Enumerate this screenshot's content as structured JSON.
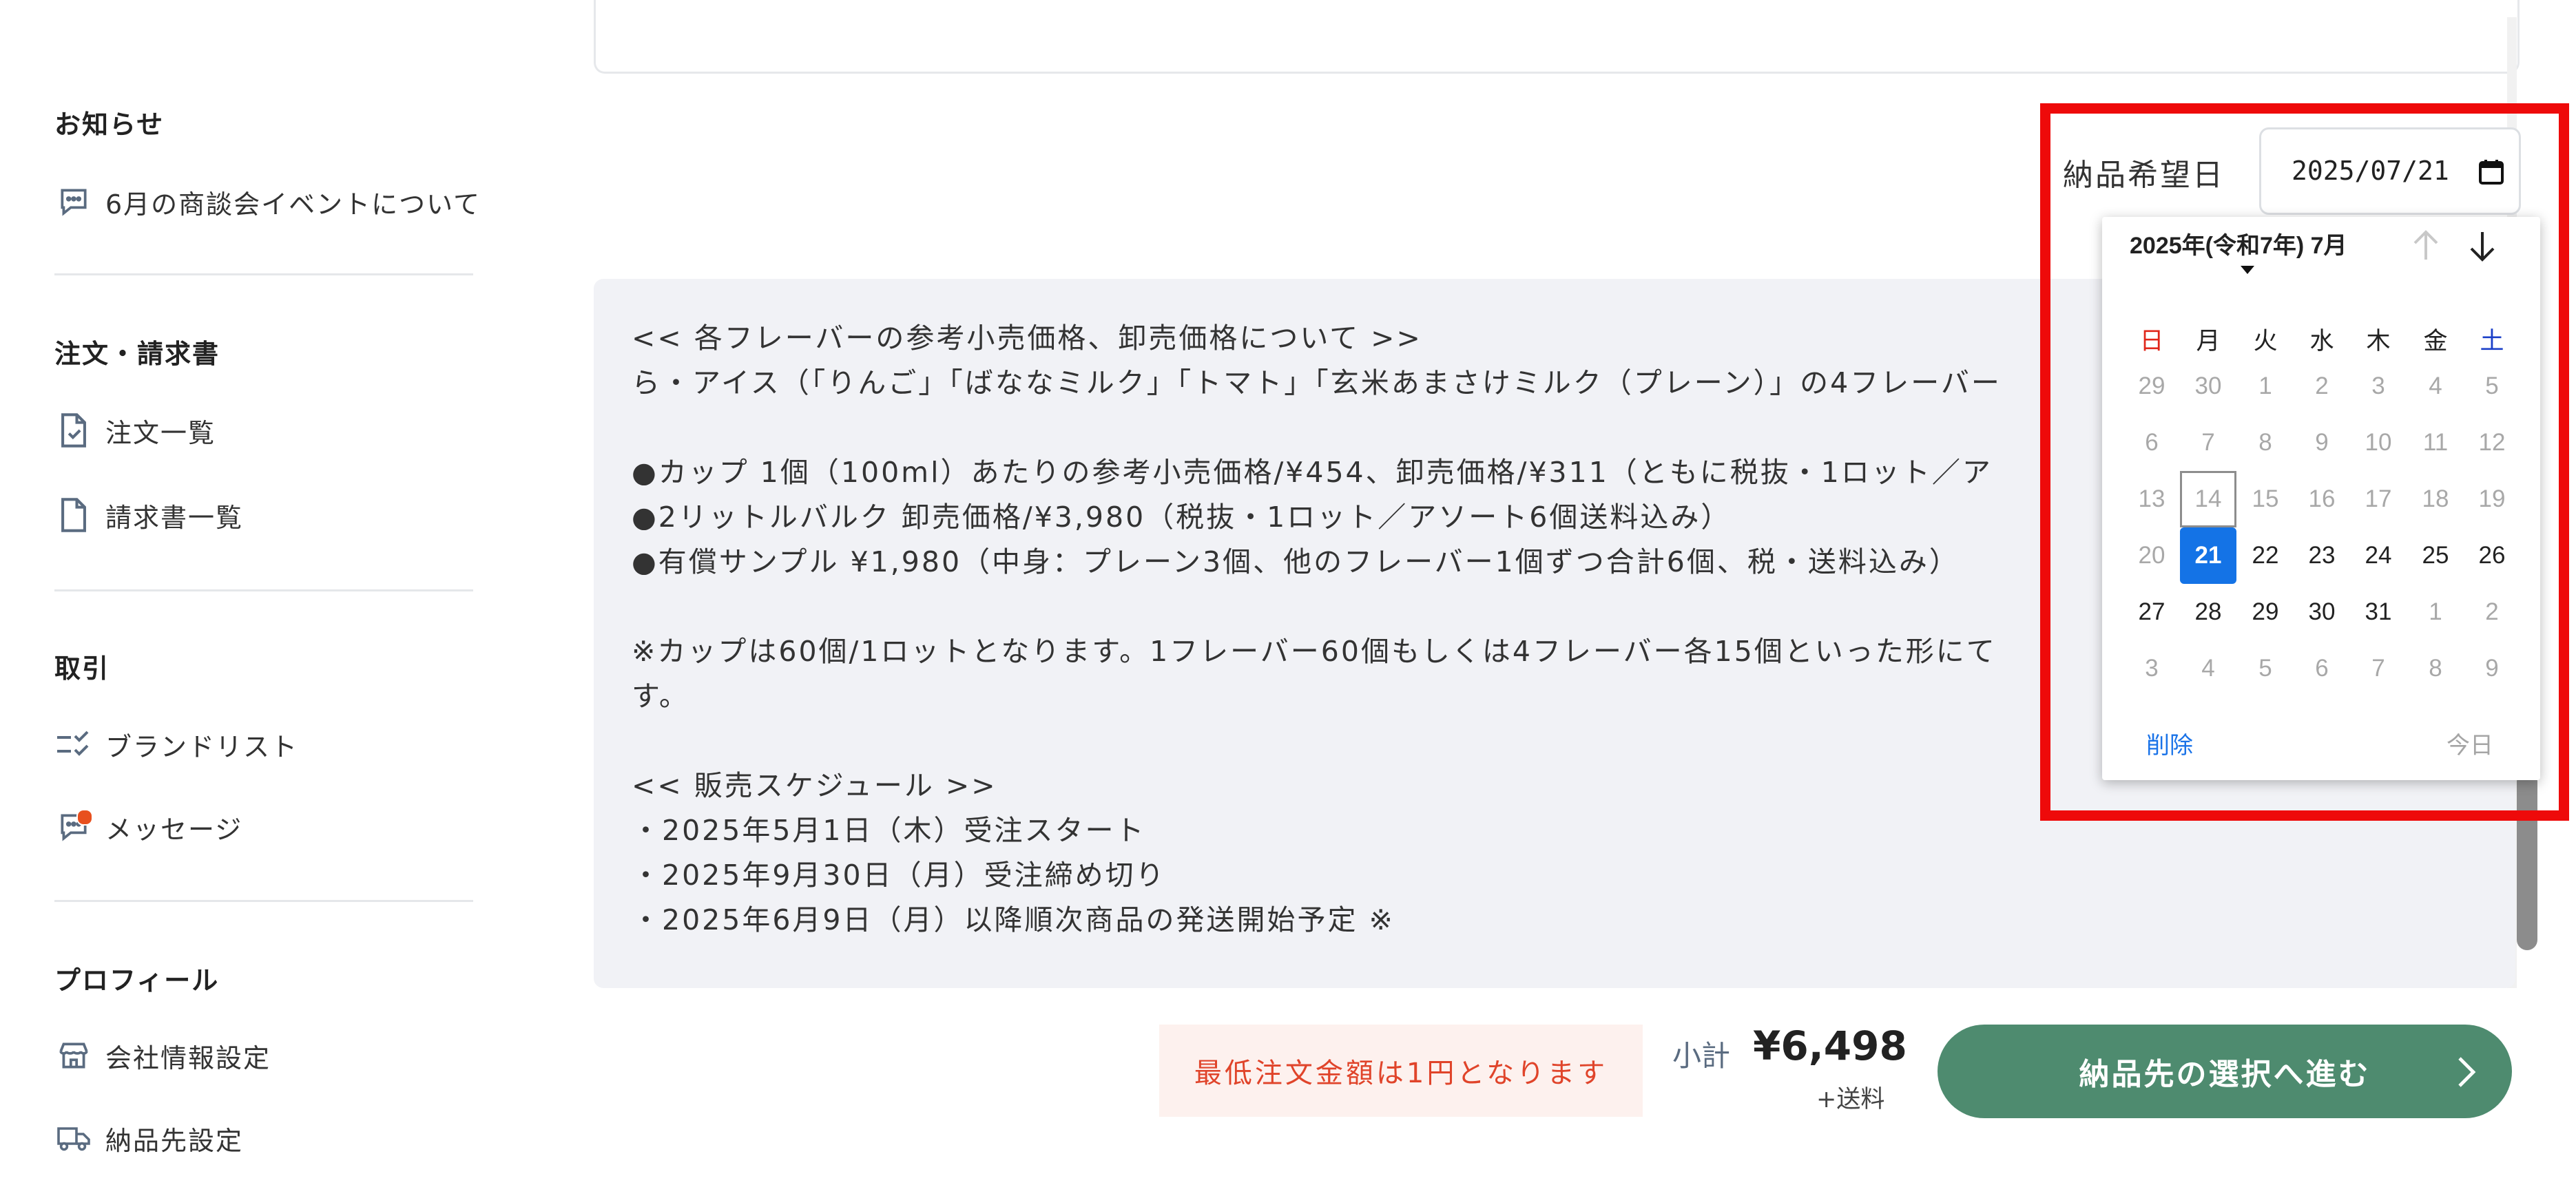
{
  "sidebar": {
    "notice_title": "お知らせ",
    "notice_item": "6月の商談会イベントについて",
    "orders_title": "注文・請求書",
    "order_list": "注文一覧",
    "invoice_list": "請求書一覧",
    "trade_title": "取引",
    "brand_list": "ブランドリスト",
    "messages": "メッセージ",
    "profile_title": "プロフィール",
    "company_settings": "会社情報設定",
    "delivery_settings": "納品先設定"
  },
  "description": {
    "lines": [
      "<< 各フレーバーの参考小売価格、卸売価格について >>",
      "ら・アイス（「りんご」「ばななミルク」「トマト」「玄米あまさけミルク（プレーン）」の4フレーバー",
      "",
      "●カップ 1個（100ml）あたりの参考小売価格/¥454、卸売価格/¥311（ともに税抜・1ロット／ア",
      "●2リットルバルク 卸売価格/¥3,980（税抜・1ロット／アソート6個送料込み）",
      "●有償サンプル ¥1,980（中身：プレーン3個、他のフレーバー1個ずつ合計6個、税・送料込み）",
      "",
      "※カップは60個/1ロットとなります。1フレーバー60個もしくは4フレーバー各15個といった形にて",
      "す。",
      "",
      "<< 販売スケジュール >>",
      "・2025年5月1日（木）受注スタート",
      "・2025年9月30日（月）受注締め切り",
      "・2025年6月9日（月）以降順次商品の発送開始予定 ※"
    ]
  },
  "delivery": {
    "label": "納品希望日",
    "value": "2025/07/21"
  },
  "calendar": {
    "month_label": "2025年(令和7年) 7月",
    "weekdays": [
      "日",
      "月",
      "火",
      "水",
      "木",
      "金",
      "土"
    ],
    "weeks": [
      [
        "29",
        "30",
        "1",
        "2",
        "3",
        "4",
        "5"
      ],
      [
        "6",
        "7",
        "8",
        "9",
        "10",
        "11",
        "12"
      ],
      [
        "13",
        "14",
        "15",
        "16",
        "17",
        "18",
        "19"
      ],
      [
        "20",
        "21",
        "22",
        "23",
        "24",
        "25",
        "26"
      ],
      [
        "27",
        "28",
        "29",
        "30",
        "31",
        "1",
        "2"
      ],
      [
        "3",
        "4",
        "5",
        "6",
        "7",
        "8",
        "9"
      ]
    ],
    "selected_day": "21",
    "today_day": "14",
    "clear_label": "削除",
    "today_label": "今日",
    "sunday_color": "#e0261a",
    "saturday_color": "#1a3fc8",
    "selected_color": "#1473e6"
  },
  "footer": {
    "min_order_notice": "最低注文金額は1円となります",
    "subtotal_label": "小計",
    "subtotal_value": "¥6,498",
    "shipping_note": "+送料",
    "proceed_button": "納品先の選択へ進む"
  },
  "colors": {
    "primary_green": "#4e8b6f",
    "notice_red": "#e0442a",
    "notice_bg": "#fdf1ee",
    "highlight_red": "#ee0a0a",
    "message_dot": "#e8501e"
  }
}
